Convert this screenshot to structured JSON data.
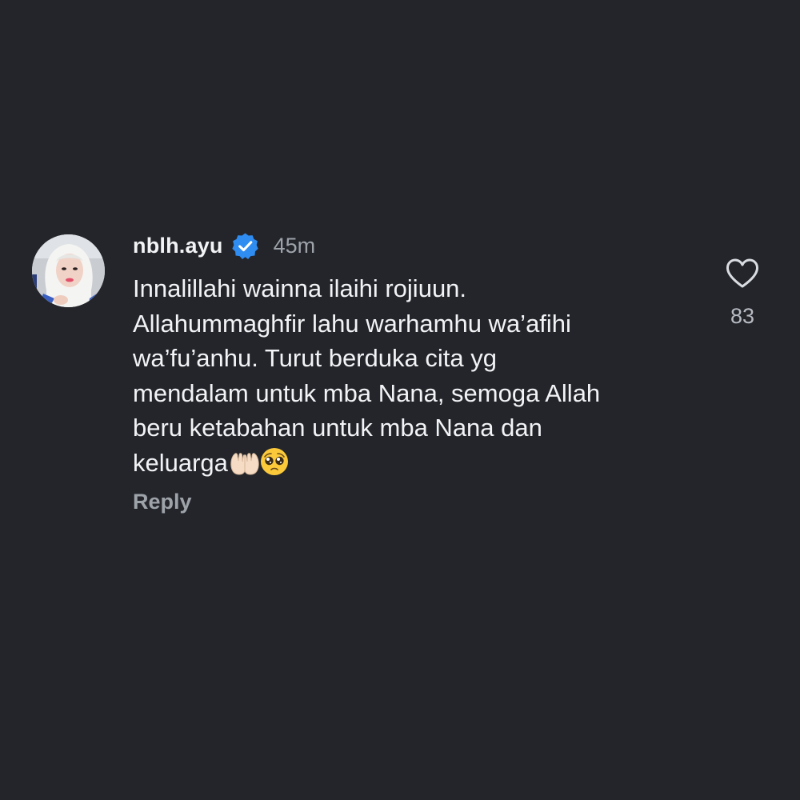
{
  "comment": {
    "username": "nblh.ayu",
    "verified_icon": "verified-badge-icon",
    "timestamp": "45m",
    "text_lines": [
      "Innalillahi wainna ilaihi rojiuun.",
      "Allahummaghfir lahu warhamhu wa’afihi",
      "wa’fu’anhu. Turut berduka cita yg",
      "mendalam untuk mba Nana, semoga Allah",
      "beru ketabahan untuk mba Nana dan",
      "keluarga"
    ],
    "emojis": [
      "palms-up-together-emoji",
      "pleading-face-emoji"
    ],
    "reply_label": "Reply",
    "like_icon": "heart-outline-icon",
    "like_count": "83"
  },
  "colors": {
    "background": "#23252b",
    "primary_text": "#f2f3f5",
    "secondary_text": "#9ea3aa",
    "verified_blue": "#2f8cf0"
  }
}
